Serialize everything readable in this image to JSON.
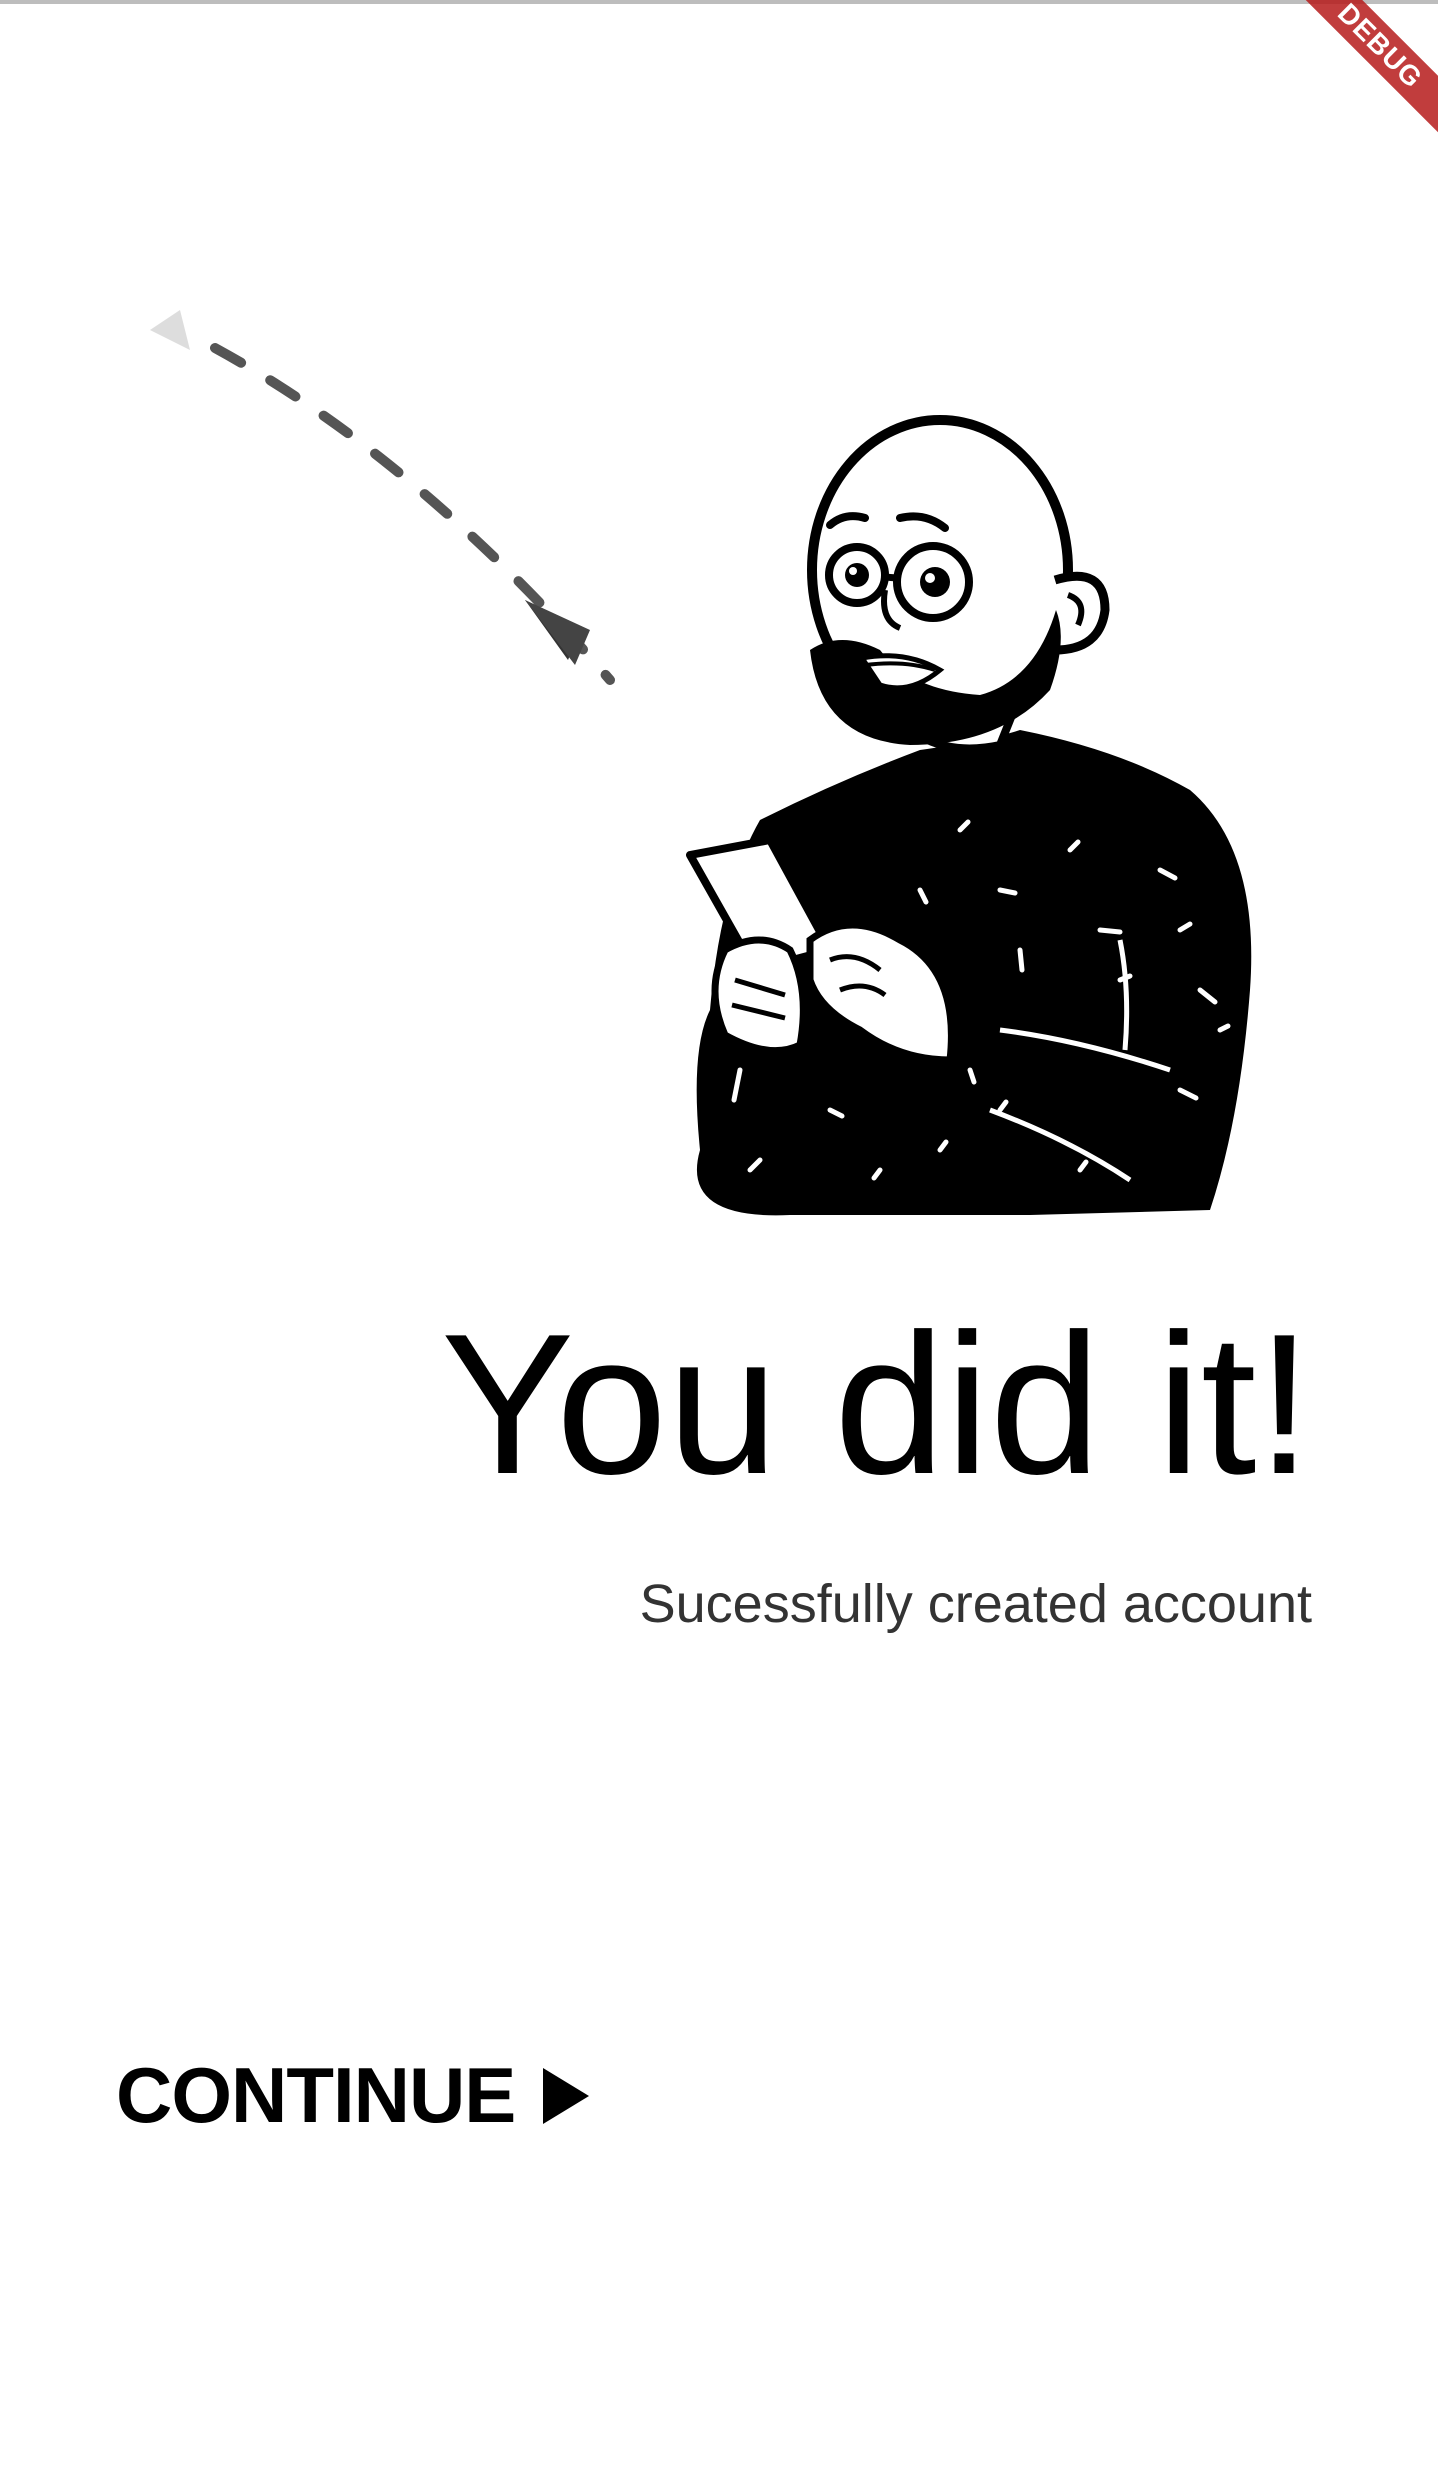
{
  "debug_banner": {
    "label": "DEBUG"
  },
  "success": {
    "title": "You did it!",
    "subtitle": "Sucessfully created account"
  },
  "actions": {
    "continue_label": "CONTINUE",
    "continue_icon": "play-triangle-icon"
  },
  "illustration": {
    "name": "bald-man-holding-phone",
    "arrow_icon": "dashed-arrow-icon"
  }
}
